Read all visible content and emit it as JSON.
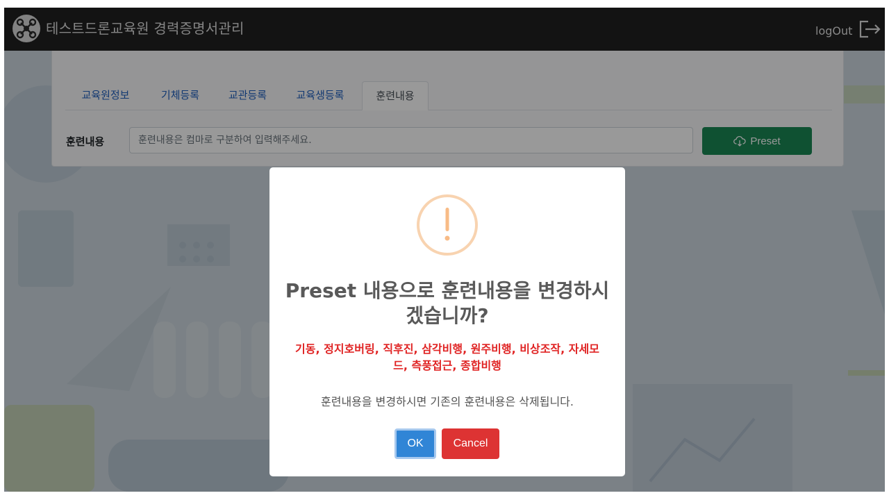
{
  "navbar": {
    "title": "테스트드론교육원 경력증명서관리",
    "logout_label": "logOut",
    "logo_icon": "drone-logo-icon",
    "logout_icon": "logout-icon"
  },
  "tabs": [
    {
      "label": "교육원정보",
      "active": false
    },
    {
      "label": "기체등록",
      "active": false
    },
    {
      "label": "교관등록",
      "active": false
    },
    {
      "label": "교육생등록",
      "active": false
    },
    {
      "label": "훈련내용",
      "active": true
    }
  ],
  "form": {
    "label": "훈련내용",
    "input_value": "",
    "input_placeholder": "훈련내용은 컴마로 구분하여 입력해주세요.",
    "preset_label": "Preset",
    "preset_icon": "cloud-download-icon"
  },
  "modal": {
    "icon": "warning-icon",
    "title": "Preset 내용으로 훈련내용을 변경하시겠습니까?",
    "list": "기동, 정지호버링, 직후진, 삼각비행, 원주비행, 비상조작, 자세모드, 측풍접근, 종합비행",
    "message": "훈련내용을 변경하시면 기존의 훈련내용은 삭제됩니다.",
    "ok_label": "OK",
    "cancel_label": "Cancel"
  },
  "colors": {
    "navbar_bg": "#212121",
    "preset_button": "#198754",
    "ok_button": "#3085d6",
    "cancel_button": "#dd3333",
    "warning_icon": "#f8bb86",
    "list_text": "#e02424"
  }
}
